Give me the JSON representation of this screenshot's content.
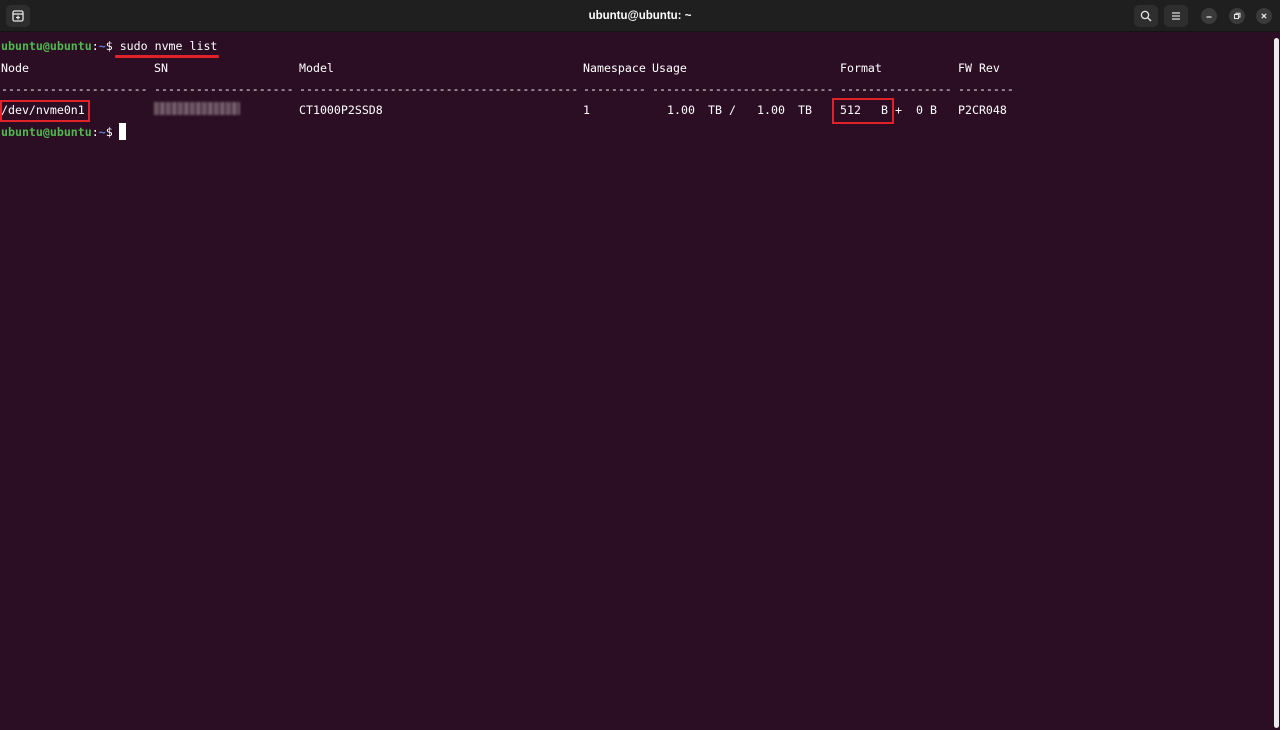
{
  "window": {
    "title": "ubuntu@ubuntu: ~",
    "icons": {
      "new_tab": "new-tab-icon",
      "search": "search-icon",
      "menu": "hamburger-menu-icon",
      "minimize": "minimize-icon",
      "restore": "restore-icon",
      "close": "close-icon"
    }
  },
  "terminal": {
    "prompt": {
      "user_host": "ubuntu@ubuntu",
      "sep": ":",
      "path": "~",
      "symbol": "$"
    },
    "command": "sudo nvme list",
    "headers": {
      "node": "Node",
      "sn": "SN",
      "model": "Model",
      "namespace": "Namespace",
      "usage": "Usage",
      "format": "Format",
      "fw_rev": "FW Rev"
    },
    "dashes": {
      "node": "---------------------",
      "sn": "--------------------",
      "model": "----------------------------------------",
      "namespace": "---------",
      "usage": "--------------------------",
      "format": "----------------",
      "fw_rev": "--------"
    },
    "row": {
      "node": "/dev/nvme0n1",
      "model": "CT1000P2SSD8",
      "namespace": "1",
      "usage_used": "1.00",
      "usage_used_unit": "TB",
      "usage_slash": "/",
      "usage_total": "1.00",
      "usage_total_unit": "TB",
      "format_size": "512",
      "format_unit": "B",
      "format_plus": "+",
      "format_meta": "0 B",
      "fw_rev": "P2CR048"
    }
  },
  "colors": {
    "background": "#2c0e24",
    "prompt_user": "#4eb94e",
    "prompt_path": "#5a7fd0",
    "highlight": "#e0232a"
  }
}
